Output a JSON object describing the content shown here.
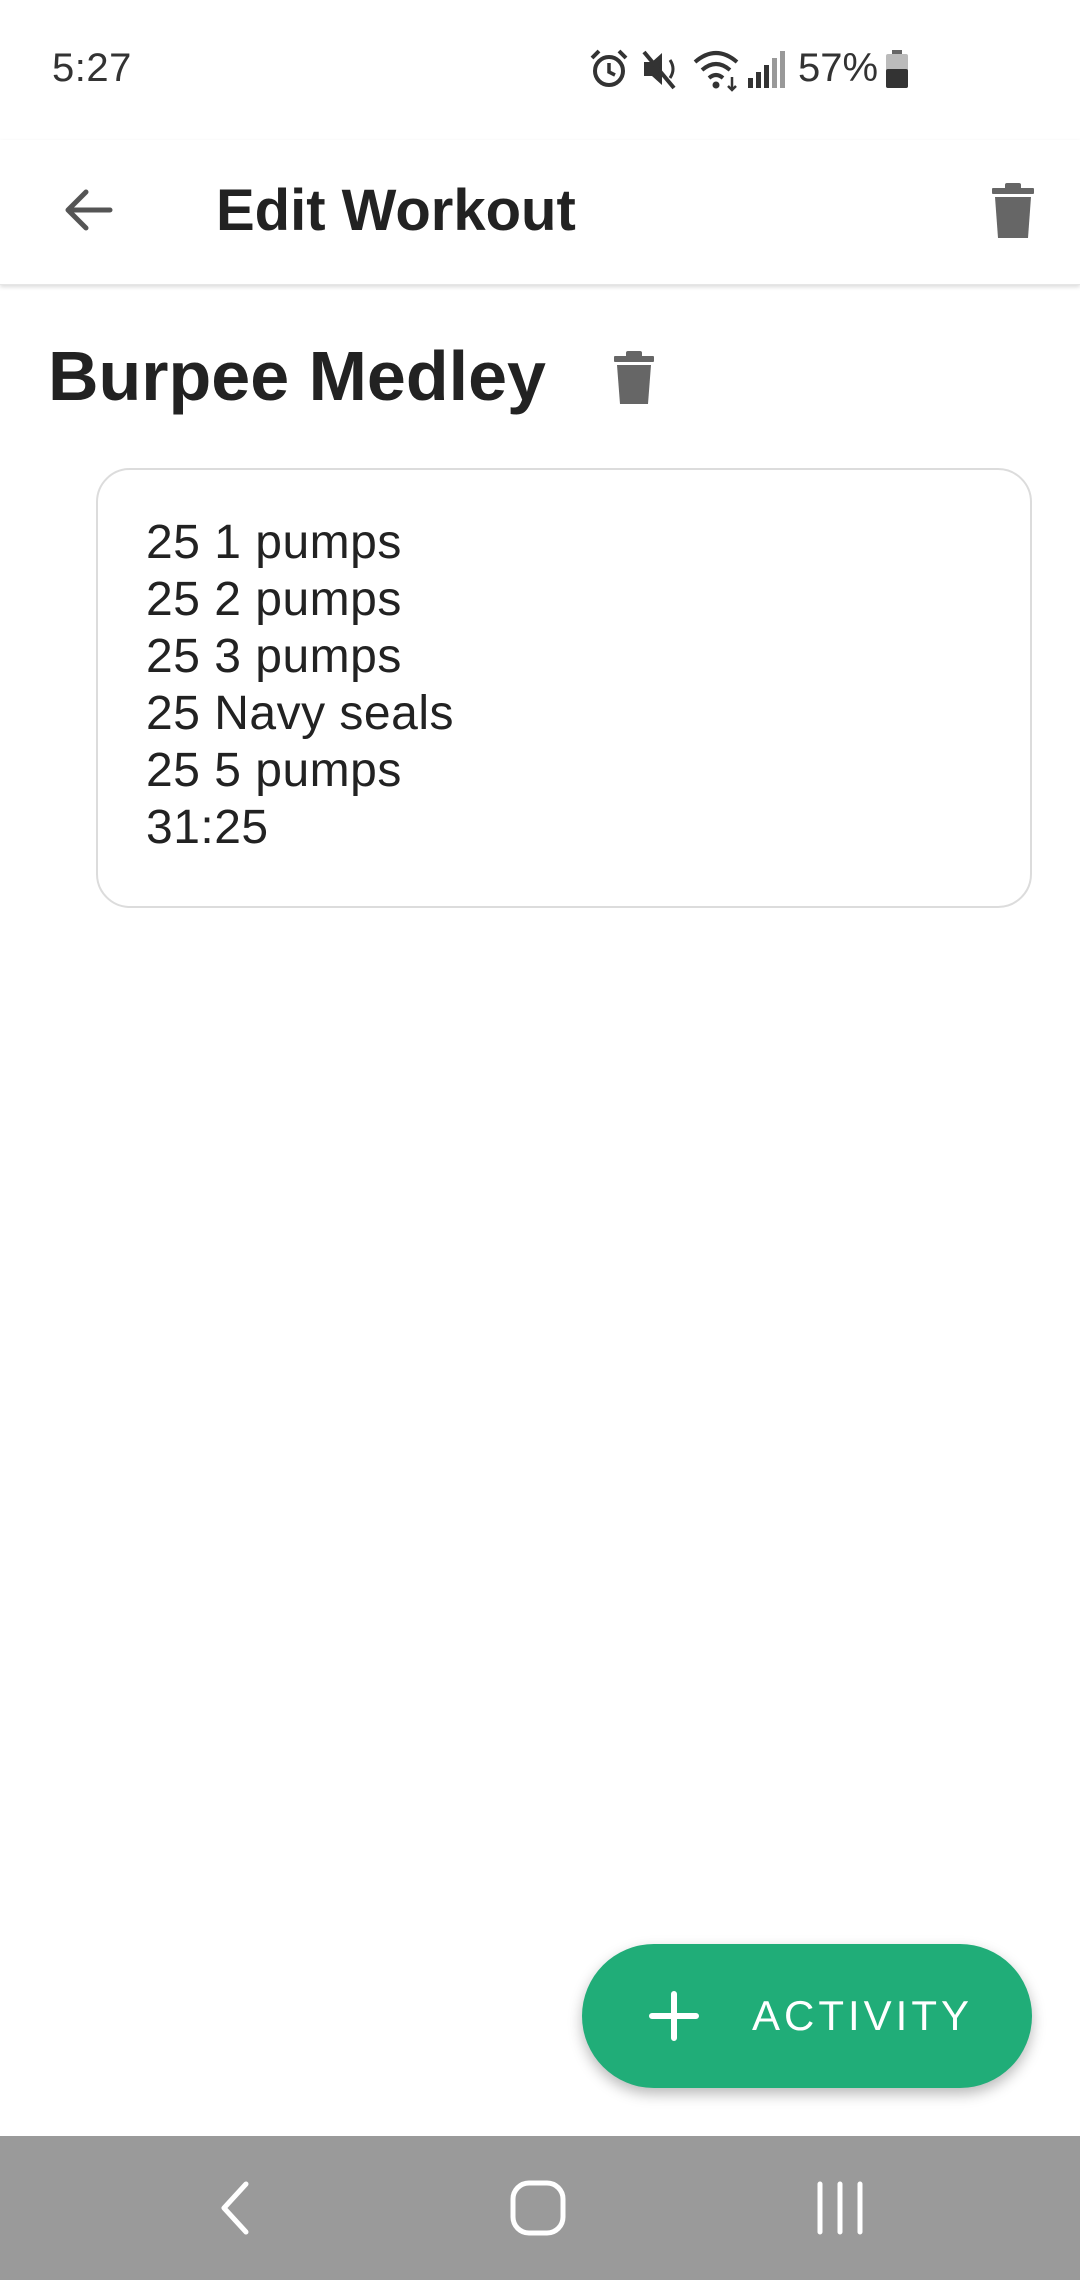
{
  "status_bar": {
    "time": "5:27",
    "battery_text": "57%",
    "icons": [
      "alarm-icon",
      "mute-icon",
      "wifi-icon",
      "signal-icon",
      "battery-icon"
    ]
  },
  "app_bar": {
    "title": "Edit Workout",
    "back_icon": "arrow-left-icon",
    "delete_icon": "trash-icon"
  },
  "workout": {
    "title": "Burpee Medley",
    "notes": [
      "25 1 pumps",
      "25 2 pumps",
      "25 3 pumps",
      "25 Navy seals",
      "25 5 pumps",
      "31:25"
    ]
  },
  "fab": {
    "label": "ACTIVITY",
    "icon": "plus-icon"
  },
  "nav_bar": {
    "buttons": [
      "back-nav-icon",
      "home-nav-icon",
      "recents-nav-icon"
    ]
  },
  "colors": {
    "accent": "#20ad78",
    "text": "#222222",
    "icon_gray": "#666666",
    "nav_bar": "#9a9a9a"
  }
}
